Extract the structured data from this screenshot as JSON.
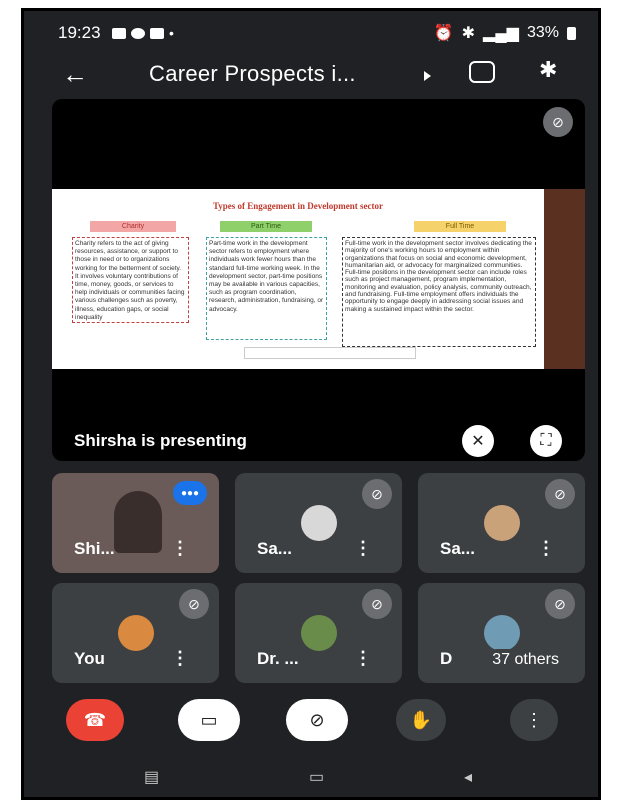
{
  "status_bar": {
    "time": "19:23",
    "battery": "33%"
  },
  "top_bar": {
    "title": "Career Prospects i..."
  },
  "slide": {
    "heading": "Types of Engagement in Development sector",
    "columns": [
      {
        "label": "Charity",
        "text": "Charity refers to the act of giving resources, assistance, or support to those in need or to organizations working for the betterment of society. It involves voluntary contributions of time, money, goods, or services to help individuals or communities facing various challenges such as poverty, illness, education gaps, or social inequality",
        "color": "#f08080"
      },
      {
        "label": "Part Time",
        "text": "Part-time work in the development sector refers to employment where individuals work fewer hours than the standard full-time working week. In the development sector, part-time positions may be available in various capacities, such as program coordination, research, administration, fundraising, or advocacy.",
        "color": "#8fd06a"
      },
      {
        "label": "Full Time",
        "text": "Full-time work in the development sector involves dedicating the majority of one's working hours to employment within organizations that focus on social and economic development, humanitarian aid, or advocacy for marginalized communities. Full-time positions in the development sector can include roles such as project management, program implementation, monitoring and evaluation, policy analysis, community outreach, and fundraising. Full-time employment offers individuals the opportunity to engage deeply in addressing social issues and making a sustained impact within the sector.",
        "color": "#f5d36a"
      }
    ]
  },
  "presenting_text": "Shirsha is presenting",
  "participants": [
    {
      "name": "Shi...",
      "speaking": true
    },
    {
      "name": "Sa...",
      "muted": true
    },
    {
      "name": "Sa...",
      "muted": true
    },
    {
      "name": "You",
      "muted": true
    },
    {
      "name": "Dr. ...",
      "muted": true
    },
    {
      "name": "D",
      "muted": true,
      "others_label": "37 others"
    }
  ],
  "controls": [
    "end-call",
    "camera-off",
    "mic-off",
    "raise-hand",
    "more"
  ],
  "colors": {
    "background": "#202124",
    "tile": "#3c4043",
    "end_call": "#ea4335",
    "speaking": "#1a73e8"
  }
}
